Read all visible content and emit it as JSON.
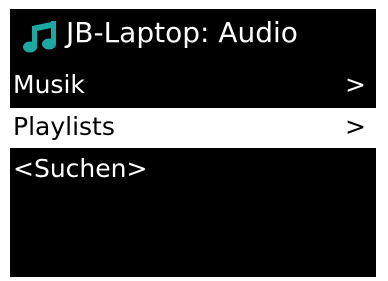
{
  "colors": {
    "screen_background": "#000000",
    "text": "#ffffff",
    "selection_background": "#ffffff",
    "selection_text": "#000000",
    "icon_accent": "#1aa8a3"
  },
  "header": {
    "icon": "music-note-icon",
    "title": "JB-Laptop: Audio"
  },
  "menu": {
    "items": [
      {
        "label": "Musik",
        "arrow": ">",
        "selected": false
      },
      {
        "label": "Playlists",
        "arrow": ">",
        "selected": true
      },
      {
        "label": "<Suchen>",
        "arrow": "",
        "selected": false
      }
    ]
  }
}
